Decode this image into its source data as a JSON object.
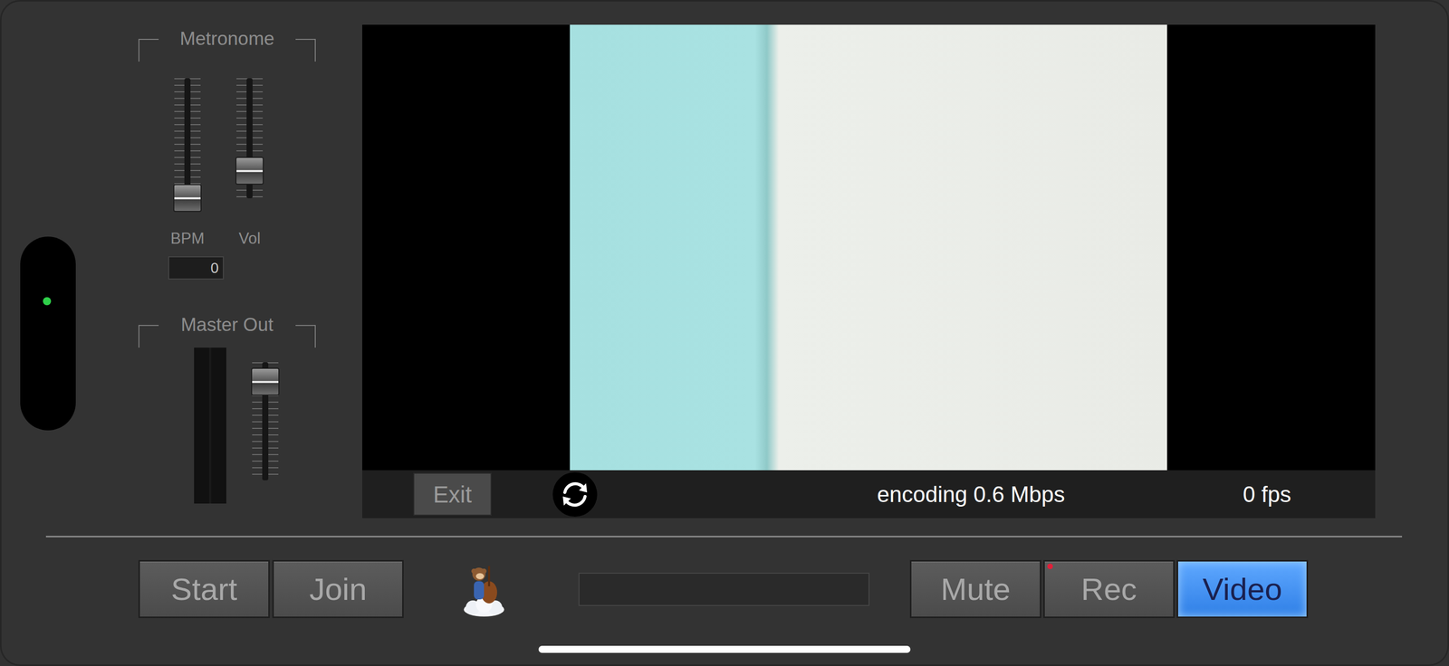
{
  "status_indicator": {
    "on": true
  },
  "metronome": {
    "title": "Metronome",
    "sliders": [
      {
        "label": "BPM",
        "level": 0.0
      },
      {
        "label": "Vol",
        "level": 0.15
      }
    ],
    "bpm_value": "0"
  },
  "master_out": {
    "title": "Master Out",
    "meter_level": 0,
    "fader_level": 0.94
  },
  "video": {
    "exit_label": "Exit",
    "encoding": "encoding 0.6 Mbps",
    "fps": "0 fps"
  },
  "toolbar": {
    "left_buttons": [
      {
        "label": "Start",
        "selected": false
      },
      {
        "label": "Join",
        "selected": false
      }
    ],
    "status_text": "",
    "right_buttons": [
      {
        "label": "Mute",
        "selected": false,
        "indicator": false
      },
      {
        "label": "Rec",
        "selected": false,
        "indicator": true
      },
      {
        "label": "Video",
        "selected": true,
        "indicator": false
      }
    ]
  }
}
